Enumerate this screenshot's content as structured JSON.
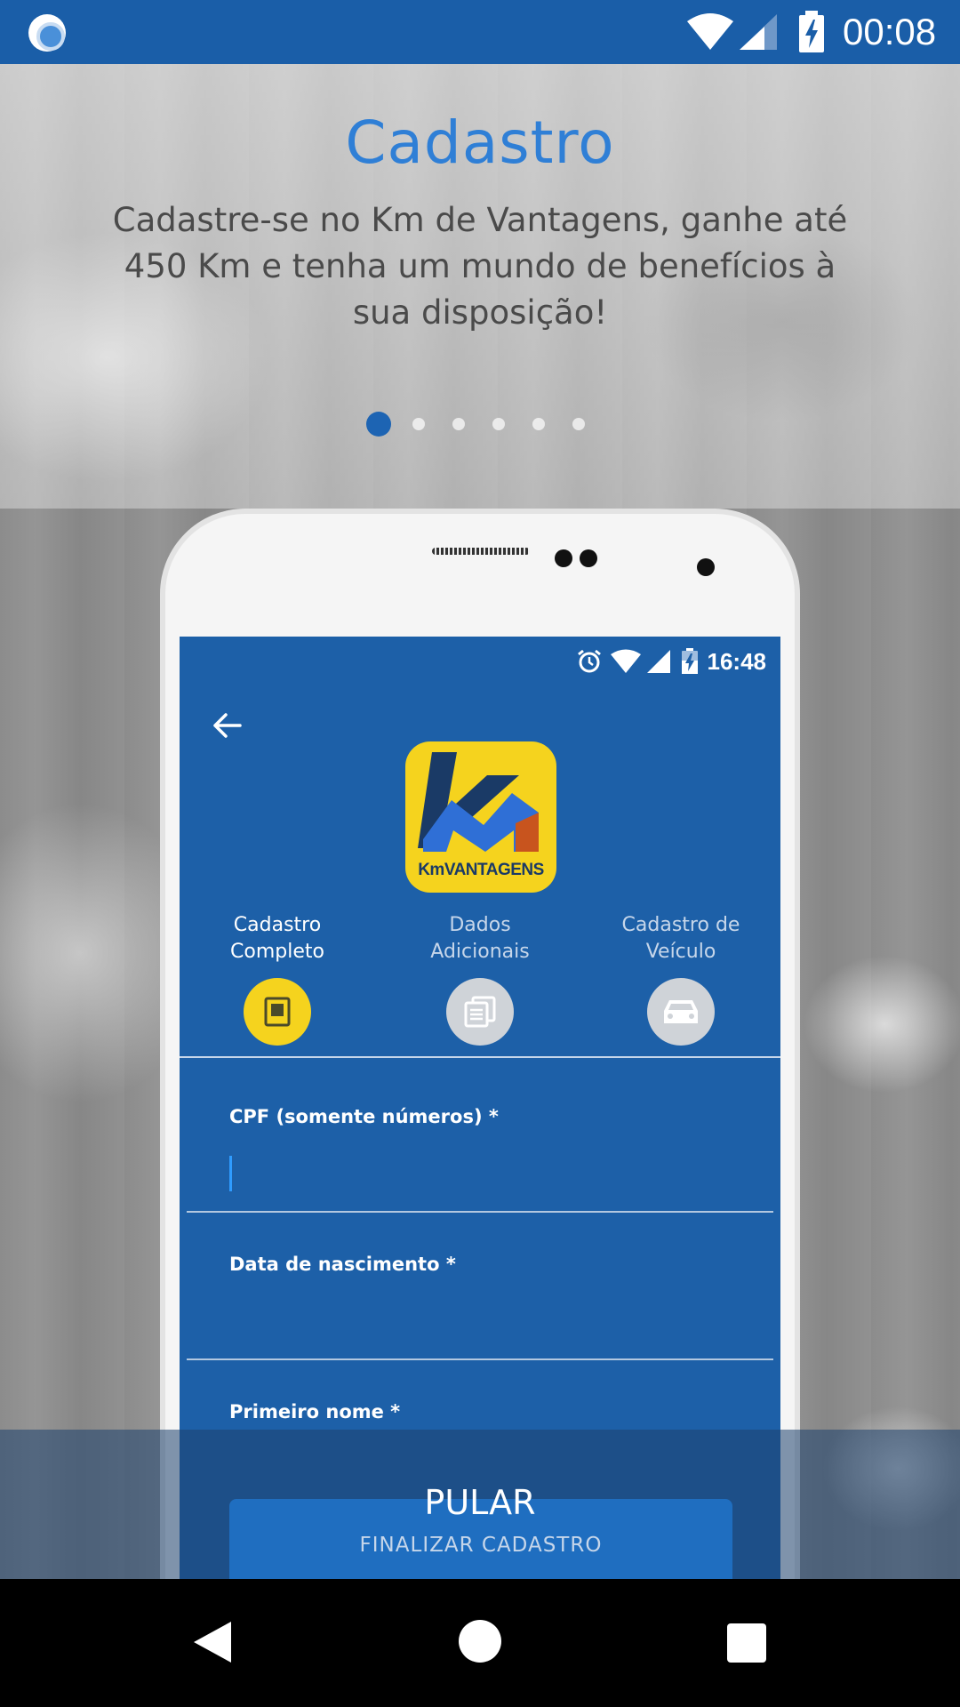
{
  "status_bar": {
    "time": "00:08",
    "icons": [
      "app-notification-icon",
      "wifi-icon",
      "signal-icon",
      "battery-charging-icon"
    ]
  },
  "slide": {
    "title": "Cadastro",
    "description": "Cadastre-se no Km de Vantagens,  ganhe até 450 Km e tenha um mundo de benefícios à sua disposição!",
    "page_indicator": {
      "current": 1,
      "total": 6
    }
  },
  "phone_screen": {
    "status_time": "16:48",
    "status_icons": [
      "alarm-icon",
      "wifi-icon",
      "signal-icon",
      "battery-charging-icon"
    ],
    "logo_text": "KmVANTAGENS",
    "steps": [
      {
        "label_line1": "Cadastro",
        "label_line2": "Completo",
        "icon": "document-icon",
        "active": true
      },
      {
        "label_line1": "Dados",
        "label_line2": "Adicionais",
        "icon": "documents-icon",
        "active": false
      },
      {
        "label_line1": "Cadastro de",
        "label_line2": "Veículo",
        "icon": "car-icon",
        "active": false
      }
    ],
    "fields": [
      {
        "label": "CPF (somente números) *",
        "value": ""
      },
      {
        "label": "Data de nascimento *",
        "value": ""
      },
      {
        "label": "Primeiro nome *",
        "value": ""
      }
    ],
    "finalize_label": "FINALIZAR CADASTRO"
  },
  "skip_label": "PULAR",
  "colors": {
    "status_bar": "#1a5ea8",
    "title": "#2f7fd6",
    "app_screen": "#1d60a8",
    "logo_yellow": "#f5d31e"
  }
}
